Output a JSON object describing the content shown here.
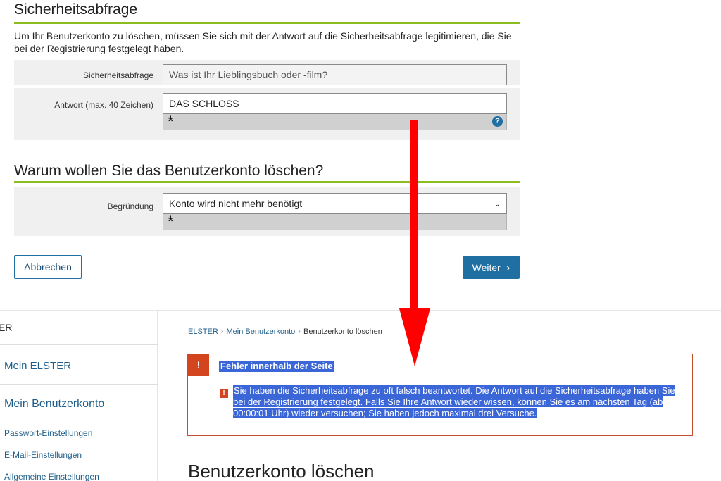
{
  "security": {
    "title": "Sicherheitsabfrage",
    "intro": "Um Ihr Benutzerkonto zu löschen, müssen Sie sich mit der Antwort auf die Sicherheitsabfrage legitimieren, die Sie bei der Registrierung festgelegt haben.",
    "question_label": "Sicherheitsabfrage",
    "question_value": "Was ist Ihr Lieblingsbuch oder -film?",
    "answer_label": "Antwort (max. 40 Zeichen)",
    "answer_value": "DAS SCHLOSS",
    "required_marker": "*",
    "help_icon": "?"
  },
  "reason": {
    "title": "Warum wollen Sie das Benutzerkonto löschen?",
    "label": "Begründung",
    "selected": "Konto wird nicht mehr benötigt",
    "required_marker": "*"
  },
  "buttons": {
    "cancel": "Abbrechen",
    "next": "Weiter",
    "next_icon": "›"
  },
  "sidebar": {
    "brand": "ER",
    "main_items": [
      "Mein ELSTER",
      "Mein Benutzerkonto"
    ],
    "sub_items": [
      "Passwort-Einstellungen",
      "E-Mail-Einstellungen",
      "Allgemeine Einstellungen"
    ]
  },
  "breadcrumb": {
    "items": [
      "ELSTER",
      "Mein Benutzerkonto",
      "Benutzerkonto löschen"
    ],
    "separator": "›"
  },
  "error": {
    "badge": "!",
    "title": "Fehler innerhalb der Seite",
    "item_icon": "!",
    "message": "Sie haben die Sicherheitsabfrage zu oft falsch beantwortet. Die Antwort auf die Sicherheitsabfrage haben Sie bei der Registrierung festgelegt. Falls Sie Ihre Antwort wieder wissen, können Sie es am nächsten Tag (ab 00:00:01 Uhr) wieder versuchen; Sie haben jedoch maximal drei Versuche."
  },
  "page_heading": "Benutzerkonto löschen",
  "colors": {
    "accent_green": "#8cbd1e",
    "primary_blue": "#1f6fa3",
    "error_red": "#d2451e",
    "selection_blue": "#3b66d8",
    "annotation_arrow": "#ff0000"
  }
}
